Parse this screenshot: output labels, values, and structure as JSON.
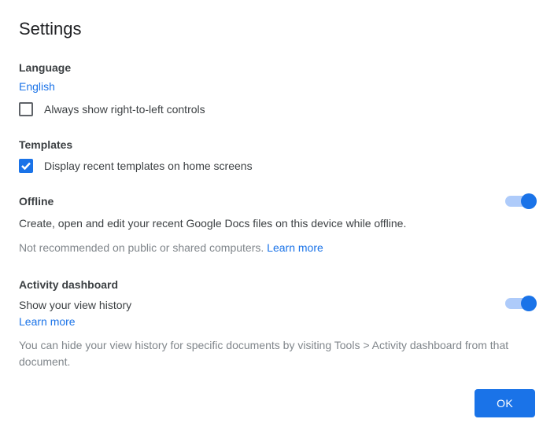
{
  "title": "Settings",
  "language": {
    "header": "Language",
    "current": "English",
    "rtl_label": "Always show right-to-left controls",
    "rtl_checked": false
  },
  "templates": {
    "header": "Templates",
    "display_label": "Display recent templates on home screens",
    "display_checked": true
  },
  "offline": {
    "header": "Offline",
    "toggle_on": true,
    "desc": "Create, open and edit your recent Google Docs files on this device while offline.",
    "warning": "Not recommended on public or shared computers. ",
    "learn_more": "Learn more"
  },
  "activity": {
    "header": "Activity dashboard",
    "toggle_on": true,
    "show_label": "Show your view history",
    "learn_more": "Learn more",
    "hint": "You can hide your view history for specific documents by visiting Tools > Activity dashboard from that document."
  },
  "ok_label": "OK"
}
